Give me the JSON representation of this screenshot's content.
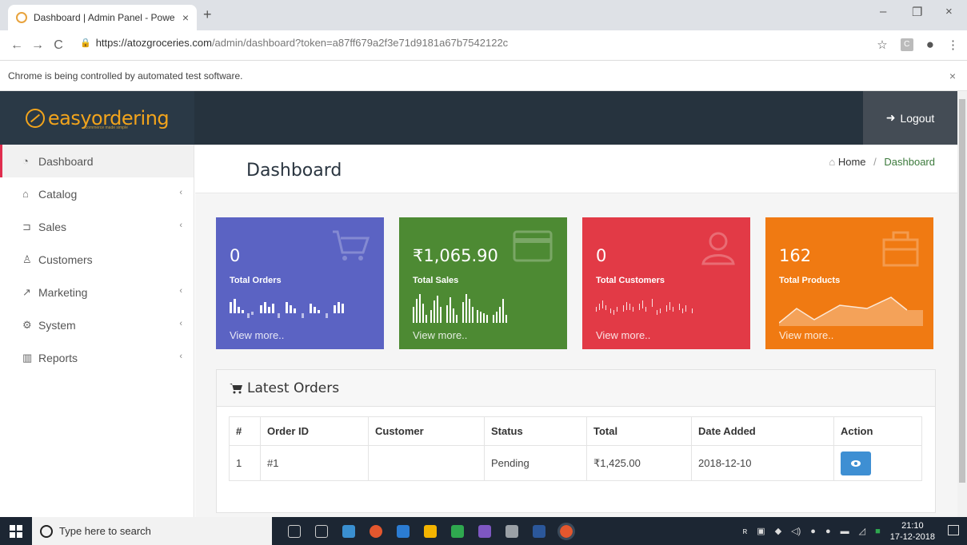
{
  "browser": {
    "tab_title": "Dashboard | Admin Panel - Powe",
    "tab_close": "×",
    "new_tab": "+",
    "url_host": "https://atozgroceries.com",
    "url_path": "/admin/dashboard?token=a87ff679a2f3e71d9181a67b7542122c",
    "infobar_text": "Chrome is being controlled by automated test software.",
    "infobar_close": "×",
    "minimize": "–",
    "restore": "❐",
    "close": "×"
  },
  "header": {
    "brand": "easyordering",
    "tagline": "ecommerce made simple",
    "logout_label": "Logout"
  },
  "sidebar": {
    "items": [
      {
        "label": "Dashboard",
        "icon": "dashboard-icon",
        "active": true
      },
      {
        "label": "Catalog",
        "icon": "tag-icon"
      },
      {
        "label": "Sales",
        "icon": "cart-icon"
      },
      {
        "label": "Customers",
        "icon": "user-icon"
      },
      {
        "label": "Marketing",
        "icon": "share-icon"
      },
      {
        "label": "System",
        "icon": "gear-icon"
      },
      {
        "label": "Reports",
        "icon": "bar-chart-icon"
      }
    ],
    "chevron": "‹"
  },
  "page": {
    "title": "Dashboard",
    "breadcrumb_home": "Home",
    "breadcrumb_sep": "/",
    "breadcrumb_current": "Dashboard"
  },
  "cards": [
    {
      "value": "0",
      "label": "Total Orders",
      "more": "View more..",
      "color": "#5b63c3"
    },
    {
      "value": "₹1,065.90",
      "label": "Total Sales",
      "more": "View more..",
      "color": "#4d8a33"
    },
    {
      "value": "0",
      "label": "Total Customers",
      "more": "View more..",
      "color": "#e23a46"
    },
    {
      "value": "162",
      "label": "Total Products",
      "more": "View more..",
      "color": "#f07a12"
    }
  ],
  "orders": {
    "title": "Latest Orders",
    "columns": [
      "#",
      "Order ID",
      "Customer",
      "Status",
      "Total",
      "Date Added",
      "Action"
    ],
    "rows": [
      {
        "num": "1",
        "order_id": "#1",
        "customer": "",
        "status": "Pending",
        "total": "₹1,425.00",
        "date": "2018-12-10"
      }
    ]
  },
  "taskbar": {
    "search_placeholder": "Type here to search",
    "time": "21:10",
    "date": "17-12-2018"
  }
}
